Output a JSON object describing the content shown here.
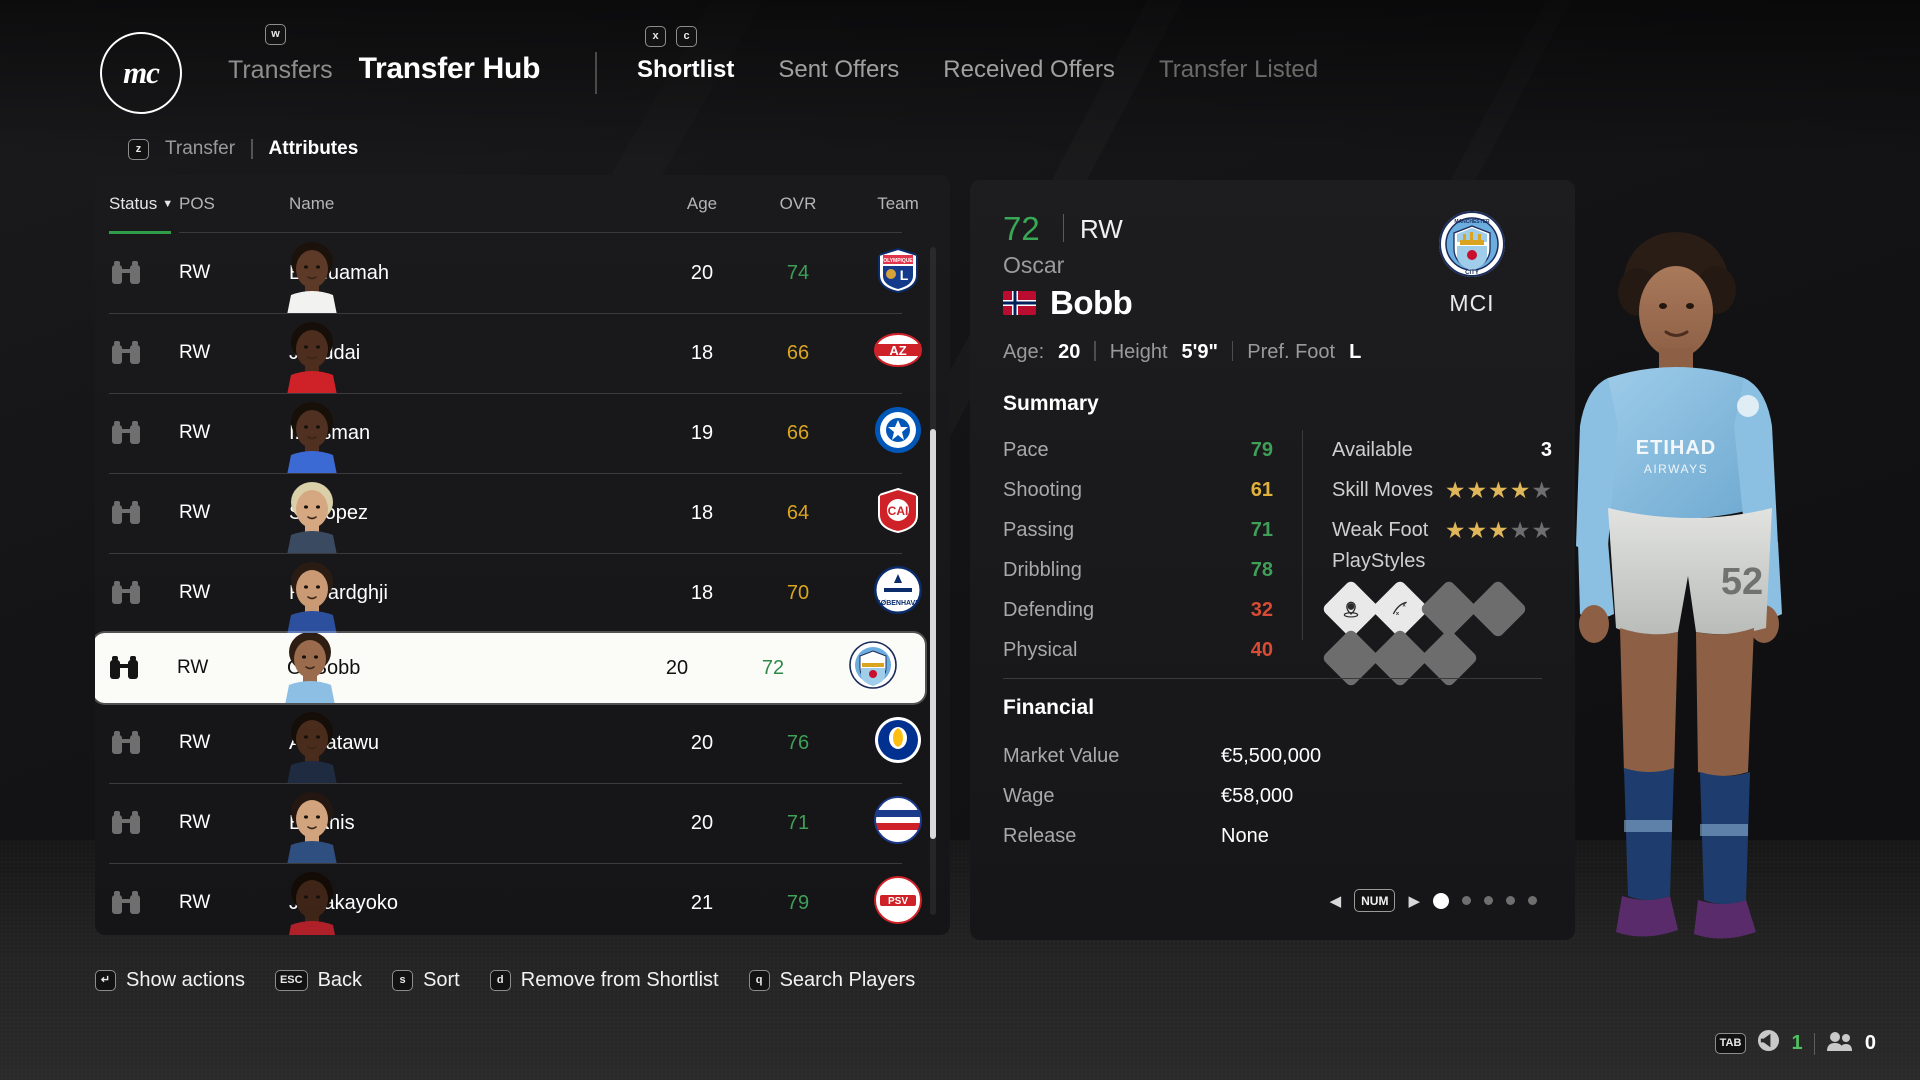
{
  "header": {
    "club_logo_text": "mc",
    "breadcrumb_key": "w",
    "breadcrumb_parent": "Transfers",
    "breadcrumb_current": "Transfer Hub",
    "tab_keys": [
      "x",
      "c"
    ],
    "tabs": [
      {
        "label": "Shortlist",
        "state": "active"
      },
      {
        "label": "Sent Offers",
        "state": "normal"
      },
      {
        "label": "Received Offers",
        "state": "normal"
      },
      {
        "label": "Transfer Listed",
        "state": "disabled"
      }
    ],
    "subtab_key": "z",
    "subtabs": [
      {
        "label": "Transfer",
        "state": "normal"
      },
      {
        "label": "Attributes",
        "state": "active"
      }
    ]
  },
  "list": {
    "columns": {
      "status": "Status",
      "pos": "POS",
      "name": "Name",
      "age": "Age",
      "ovr": "OVR",
      "team": "Team"
    },
    "sorted_by": "Status",
    "sort_carat": "▼",
    "rows": [
      {
        "status_icon": "binoculars-icon",
        "pos": "RW",
        "name": "E. Nuamah",
        "age": "20",
        "ovr": "74",
        "ovr_color": "#3f9e57",
        "team": "OL",
        "selected": false
      },
      {
        "status_icon": "binoculars-icon",
        "pos": "RW",
        "name": "J. Addai",
        "age": "18",
        "ovr": "66",
        "ovr_color": "#d9a520",
        "team": "AZ",
        "selected": false
      },
      {
        "status_icon": "binoculars-icon",
        "pos": "RW",
        "name": "I. Osman",
        "age": "19",
        "ovr": "66",
        "ovr_color": "#d9a520",
        "team": "BHA",
        "selected": false
      },
      {
        "status_icon": "binoculars-icon",
        "pos": "RW",
        "name": "S. López",
        "age": "18",
        "ovr": "64",
        "ovr_color": "#d9a520",
        "team": "CAI",
        "selected": false
      },
      {
        "status_icon": "binoculars-icon",
        "pos": "RW",
        "name": "R. Bardghji",
        "age": "18",
        "ovr": "70",
        "ovr_color": "#d9a520",
        "team": "FCK",
        "selected": false
      },
      {
        "status_icon": "binoculars-icon",
        "pos": "RW",
        "name": "O. Bobb",
        "age": "20",
        "ovr": "72",
        "ovr_color": "#2f8a49",
        "team": "MCI",
        "selected": true
      },
      {
        "status_icon": "binoculars-icon",
        "pos": "RW",
        "name": "A. Fatawu",
        "age": "20",
        "ovr": "76",
        "ovr_color": "#3f9e57",
        "team": "LEI",
        "selected": false
      },
      {
        "status_icon": "binoculars-icon",
        "pos": "RW",
        "name": "Estanis",
        "age": "20",
        "ovr": "71",
        "ovr_color": "#3f9e57",
        "team": "SAM",
        "selected": false
      },
      {
        "status_icon": "binoculars-icon",
        "pos": "RW",
        "name": "J. Bakayoko",
        "age": "21",
        "ovr": "79",
        "ovr_color": "#3f9e57",
        "team": "PSV",
        "selected": false
      }
    ]
  },
  "detail": {
    "ovr": "72",
    "ovr_color": "#39a855",
    "position": "RW",
    "first_name": "Oscar",
    "last_name": "Bobb",
    "nationality": "Norway",
    "meta": {
      "age_label": "Age:",
      "age_value": "20",
      "height_label": "Height",
      "height_value": "5'9\"",
      "foot_label": "Pref. Foot",
      "foot_value": "L"
    },
    "club_name": "MCI",
    "summary_title": "Summary",
    "stats": [
      {
        "label": "Pace",
        "value": "79",
        "color": "#3f9e57"
      },
      {
        "label": "Shooting",
        "value": "61",
        "color": "#e0b23a"
      },
      {
        "label": "Passing",
        "value": "71",
        "color": "#3f9e57"
      },
      {
        "label": "Dribbling",
        "value": "78",
        "color": "#3f9e57"
      },
      {
        "label": "Defending",
        "value": "32",
        "color": "#d84b35"
      },
      {
        "label": "Physical",
        "value": "40",
        "color": "#d84b35"
      }
    ],
    "available_label": "Available",
    "available_value": "3",
    "skill_moves_label": "Skill Moves",
    "skill_moves": 4,
    "skill_moves_max": 5,
    "weak_foot_label": "Weak Foot",
    "weak_foot": 3,
    "weak_foot_max": 5,
    "playstyles_label": "PlayStyles",
    "playstyles": [
      {
        "name": "pinged-pass-icon",
        "filled": true
      },
      {
        "name": "trickster-icon",
        "filled": true
      },
      {
        "name": "empty-slot",
        "filled": false
      },
      {
        "name": "empty-slot",
        "filled": false
      },
      {
        "name": "empty-slot",
        "filled": false
      },
      {
        "name": "empty-slot",
        "filled": false
      },
      {
        "name": "empty-slot",
        "filled": false
      }
    ],
    "financial_title": "Financial",
    "financial": [
      {
        "label": "Market Value",
        "value": "€5,500,000"
      },
      {
        "label": "Wage",
        "value": "€58,000"
      },
      {
        "label": "Release",
        "value": "None"
      }
    ],
    "pager": {
      "left_arrow": "◀",
      "key": "NUM",
      "right_arrow": "▶",
      "pages": 5,
      "active_page": 1
    }
  },
  "actionbar": [
    {
      "key": "↵",
      "label": "Show actions"
    },
    {
      "key": "ESC",
      "label": "Back"
    },
    {
      "key": "s",
      "label": "Sort"
    },
    {
      "key": "d",
      "label": "Remove from Shortlist"
    },
    {
      "key": "q",
      "label": "Search Players"
    }
  ],
  "statusbar": {
    "key": "TAB",
    "volume_count": "1",
    "players_count": "0"
  }
}
